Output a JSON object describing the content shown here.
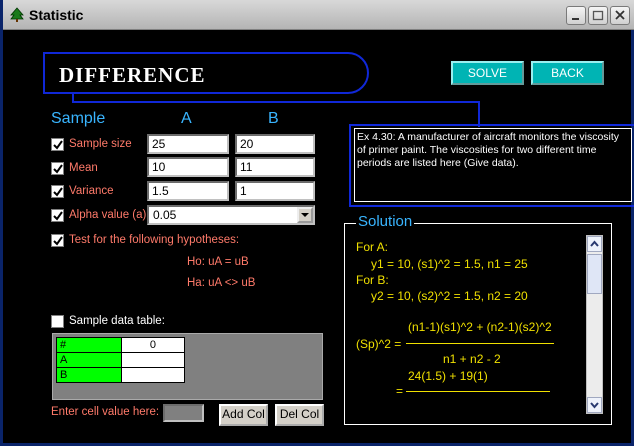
{
  "window": {
    "title": "Statistic",
    "icon": "tree-icon"
  },
  "header": {
    "heading": "DIFFERENCE",
    "solve_label": "SOLVE",
    "back_label": "BACK"
  },
  "columns": {
    "sample": "Sample",
    "a": "A",
    "b": "B"
  },
  "fields": {
    "sample_size": {
      "label": "Sample size",
      "a": "25",
      "b": "20",
      "checked": true
    },
    "mean": {
      "label": "Mean",
      "a": "10",
      "b": "11",
      "checked": true
    },
    "variance": {
      "label": "Variance",
      "a": "1.5",
      "b": "1",
      "checked": true
    },
    "alpha": {
      "label": "Alpha value (a)",
      "value": "0.05",
      "checked": true
    }
  },
  "hypotheses": {
    "label": "Test for the following hypotheses:",
    "checked": true,
    "h0": "Ho: uA = uB",
    "ha": "Ha: uA <> uB"
  },
  "data_table": {
    "label": "Sample data table:",
    "checked": false,
    "rows": [
      {
        "header": "#",
        "value": "0"
      },
      {
        "header": "A",
        "value": ""
      },
      {
        "header": "B",
        "value": ""
      }
    ],
    "cell_label": "Enter cell value here:",
    "add_col_label": "Add Col",
    "del_col_label": "Del Col"
  },
  "example": {
    "text": "Ex 4.30: A manufacturer of aircraft monitors the viscosity of primer paint. The viscosities for two different time periods are listed here (Give data)."
  },
  "solution": {
    "title": "Solution",
    "line1": "For A:",
    "line2": "y1 = 10, (s1)^2 = 1.5, n1 = 25",
    "line3": "For B:",
    "line4": "y2 = 10, (s2)^2 = 1.5, n2 = 20",
    "sp_label": "(Sp)^2 =",
    "sp_num": "(n1-1)(s1)^2 + (n2-1)(s2)^2",
    "sp_den": "n1 + n2 - 2",
    "sub_num": "24(1.5) + 19(1)",
    "sub_eq": "="
  },
  "colors": {
    "accent_blue": "#1028d8",
    "label_red": "#ff7a6a",
    "section_blue": "#39b5ff",
    "solution_yellow": "#f0e000",
    "button_teal": "#00b4b4"
  }
}
